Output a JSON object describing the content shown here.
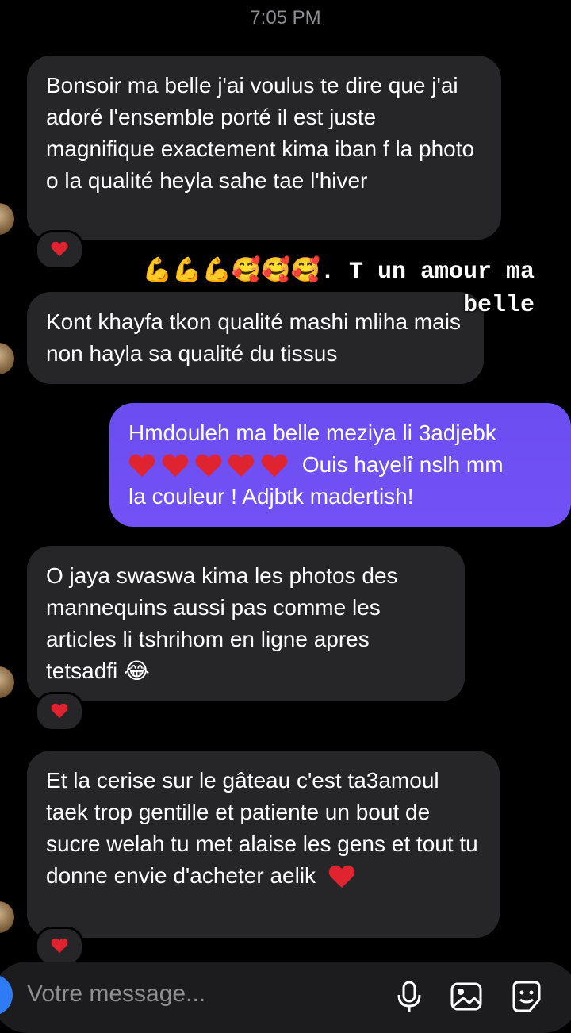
{
  "timestamp": "7:05 PM",
  "messages": [
    {
      "type": "incoming",
      "text": "Bonsoir ma belle j'ai voulus te dire que j'ai adoré l'ensemble porté il est juste magnifique exactement kima iban f la photo o la qualité heyla sahe tae l'hiver",
      "reaction": "heart"
    },
    {
      "type": "incoming",
      "text": "Kont khayfa tkon qualité mashi mliha mais non hayla sa qualité du tissus"
    },
    {
      "type": "outgoing",
      "line1": "Hmdouleh ma belle meziya li 3adjebk",
      "line2_suffix": "Ouis hayelî nslh mm",
      "line3": "la couleur ! Adjbtk madertish!"
    },
    {
      "type": "incoming",
      "text": "O jaya swaswa kima les photos des mannequins aussi pas comme les articles li tshrihom en ligne apres tetsadfi",
      "emoji": "😂",
      "reaction": "heart"
    },
    {
      "type": "incoming",
      "text": "Et la cerise sur le gâteau c'est ta3amoul taek trop gentille et patiente un bout de sucre welah tu met alaise les gens et tout tu donne envie d'acheter aelik",
      "reaction": "heart"
    }
  ],
  "overlay": {
    "emojis": "💪💪💪🥰🥰🥰",
    "text1": ". T un amour ma",
    "text2": "belle"
  },
  "composer": {
    "placeholder": "Votre message..."
  },
  "icons": {
    "mic": "microphone-icon",
    "gallery": "gallery-icon",
    "sticker": "sticker-icon"
  },
  "colors": {
    "background": "#000000",
    "incoming_bubble": "#262629",
    "outgoing_bubble": "#6b4df0",
    "heart": "#e0242f"
  }
}
